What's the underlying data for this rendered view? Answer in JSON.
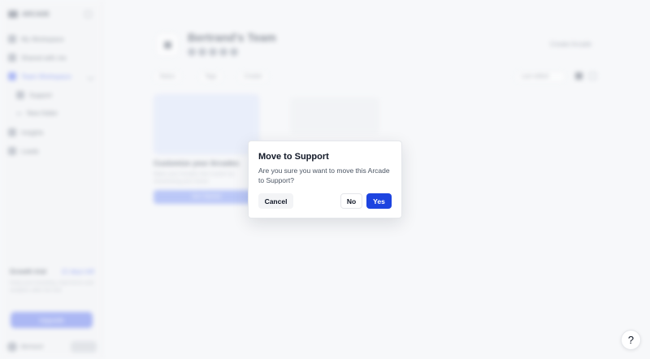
{
  "sidebar": {
    "logo": "ARCADE",
    "items": [
      {
        "label": "My Workspace"
      },
      {
        "label": "Shared with me"
      },
      {
        "label": "Team Workspace"
      },
      {
        "label": "Support"
      },
      {
        "label": "New folder"
      },
      {
        "label": "Insights"
      },
      {
        "label": "Leads"
      }
    ],
    "upsell": {
      "title": "Growth trial",
      "link": "12 days left",
      "body": "Keep your branding, lead forms and analytics after the trial."
    },
    "upgrade_label": "Upgrade",
    "user_name": "Bertrand"
  },
  "main": {
    "team_title": "Bertrand's Team",
    "create_label": "Create Arcade",
    "filters": [
      "Status",
      "Tags",
      "Creator"
    ],
    "sort_label": "Last edited",
    "card": {
      "title": "Customize your Arcades",
      "desc": "Make your Arcades feel custom by showcasing your brand.",
      "button": "Get Started"
    }
  },
  "modal": {
    "title": "Move to Support",
    "message": "Are you sure you want to move this Arcade to Support?",
    "cancel_label": "Cancel",
    "no_label": "No",
    "yes_label": "Yes"
  },
  "help": {
    "label": "?"
  },
  "colors": {
    "primary": "#1d44e0",
    "background": "#f7f8fa"
  }
}
